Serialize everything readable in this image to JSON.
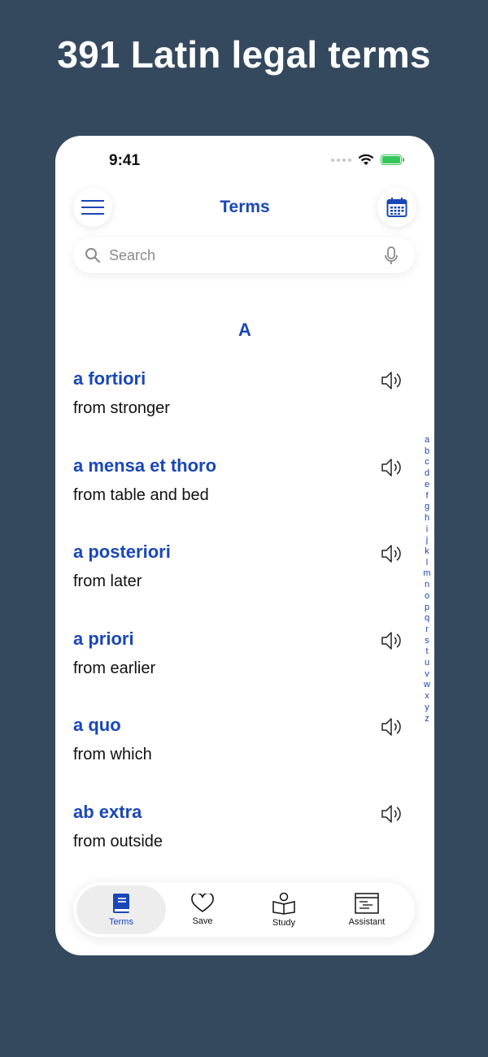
{
  "headline": "391 Latin legal terms",
  "status": {
    "time": "9:41"
  },
  "header": {
    "title": "Terms"
  },
  "search": {
    "placeholder": "Search"
  },
  "section_letter": "A",
  "terms": [
    {
      "name": "a fortiori",
      "meaning": "from stronger"
    },
    {
      "name": "a mensa et thoro",
      "meaning": "from table and bed"
    },
    {
      "name": "a posteriori",
      "meaning": "from later"
    },
    {
      "name": "a priori",
      "meaning": "from earlier"
    },
    {
      "name": "a quo",
      "meaning": "from which"
    },
    {
      "name": "ab extra",
      "meaning": "from outside"
    }
  ],
  "alphabet": [
    "a",
    "b",
    "c",
    "d",
    "e",
    "f",
    "g",
    "h",
    "i",
    "j",
    "k",
    "l",
    "m",
    "n",
    "o",
    "p",
    "q",
    "r",
    "s",
    "t",
    "u",
    "v",
    "w",
    "x",
    "y",
    "z"
  ],
  "tabs": [
    {
      "label": "Terms",
      "icon": "book-icon",
      "active": true
    },
    {
      "label": "Save",
      "icon": "heart-icon",
      "active": false
    },
    {
      "label": "Study",
      "icon": "reading-person-icon",
      "active": false
    },
    {
      "label": "Assistant",
      "icon": "assistant-screen-icon",
      "active": false
    }
  ],
  "colors": {
    "background": "#34495e",
    "accent": "#1a47b8",
    "battery": "#34c759"
  },
  "icons": {
    "menu": "hamburger-icon",
    "calendar": "calendar-icon",
    "search": "search-icon",
    "mic": "microphone-icon",
    "speaker": "speaker-icon"
  }
}
